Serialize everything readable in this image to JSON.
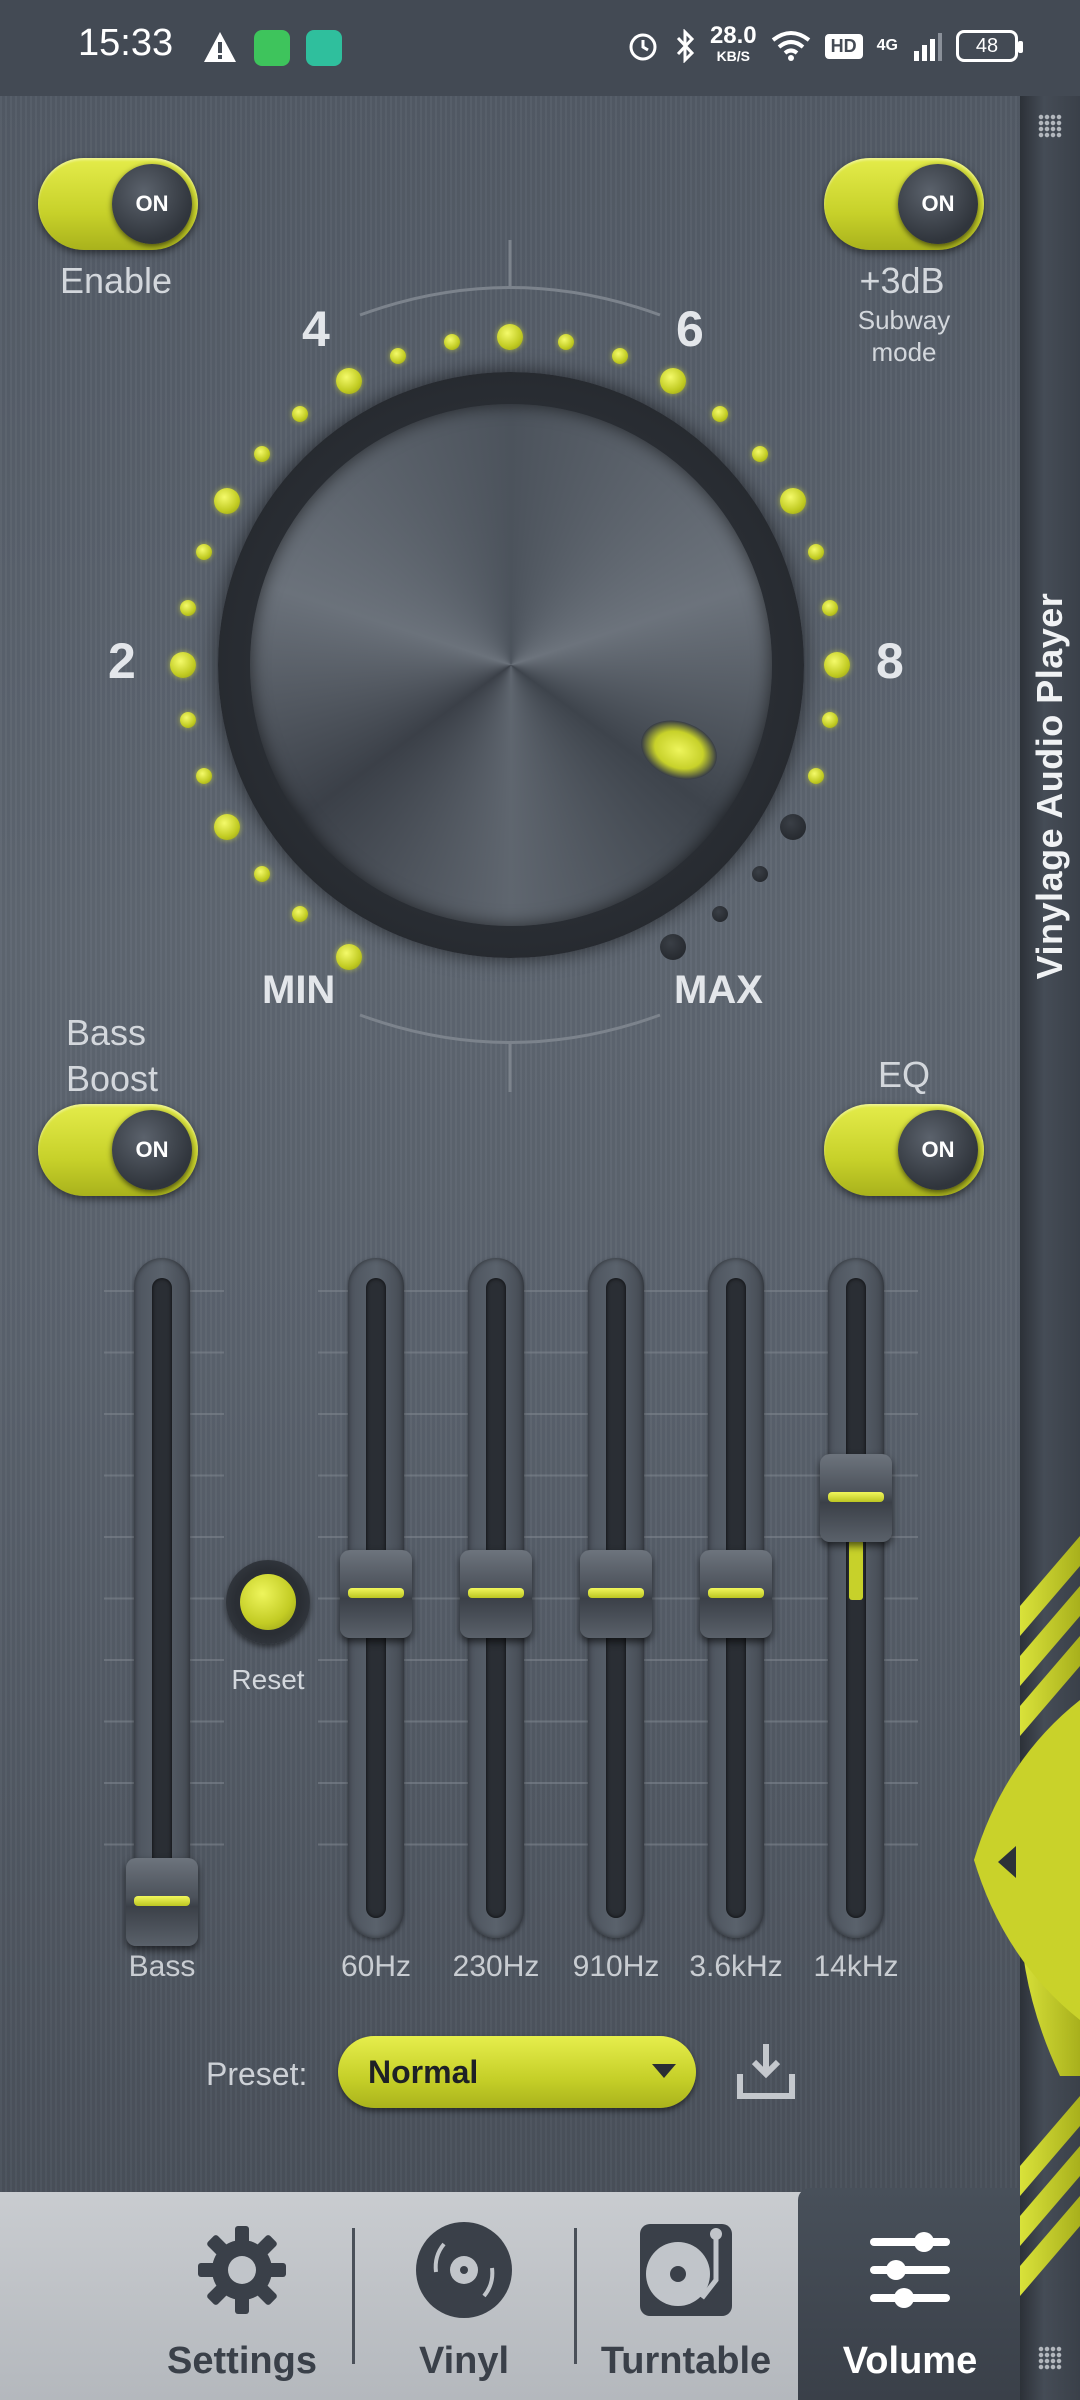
{
  "status_bar": {
    "time": "15:33",
    "speed_value": "28.0",
    "speed_unit": "KB/S",
    "hd": "HD",
    "network": "4G",
    "battery": "48"
  },
  "app": {
    "title": "Vinylage Audio Player",
    "accent_color": "#c7d12a"
  },
  "toggles": {
    "enable": {
      "state": "ON",
      "label": "Enable"
    },
    "subway": {
      "state": "ON",
      "label": "+3dB",
      "sublabel": "Subway mode"
    },
    "bass_boost": {
      "state": "ON",
      "label": "Bass Boost"
    },
    "eq": {
      "state": "ON",
      "label": "EQ"
    }
  },
  "volume_knob": {
    "scale_labels": {
      "n2": "2",
      "n4": "4",
      "n6": "6",
      "n8": "8",
      "min": "MIN",
      "max": "MAX"
    }
  },
  "equalizer": {
    "bass_label": "Bass",
    "reset_label": "Reset",
    "bands": [
      {
        "label": "60Hz"
      },
      {
        "label": "230Hz"
      },
      {
        "label": "910Hz"
      },
      {
        "label": "3.6kHz"
      },
      {
        "label": "14kHz"
      }
    ]
  },
  "preset": {
    "label": "Preset:",
    "value": "Normal"
  },
  "bottom_nav": {
    "items": [
      {
        "label": "Settings",
        "icon": "gear-icon"
      },
      {
        "label": "Vinyl",
        "icon": "vinyl-icon"
      },
      {
        "label": "Turntable",
        "icon": "turntable-icon"
      },
      {
        "label": "Volume",
        "icon": "sliders-icon",
        "active": true
      }
    ]
  }
}
